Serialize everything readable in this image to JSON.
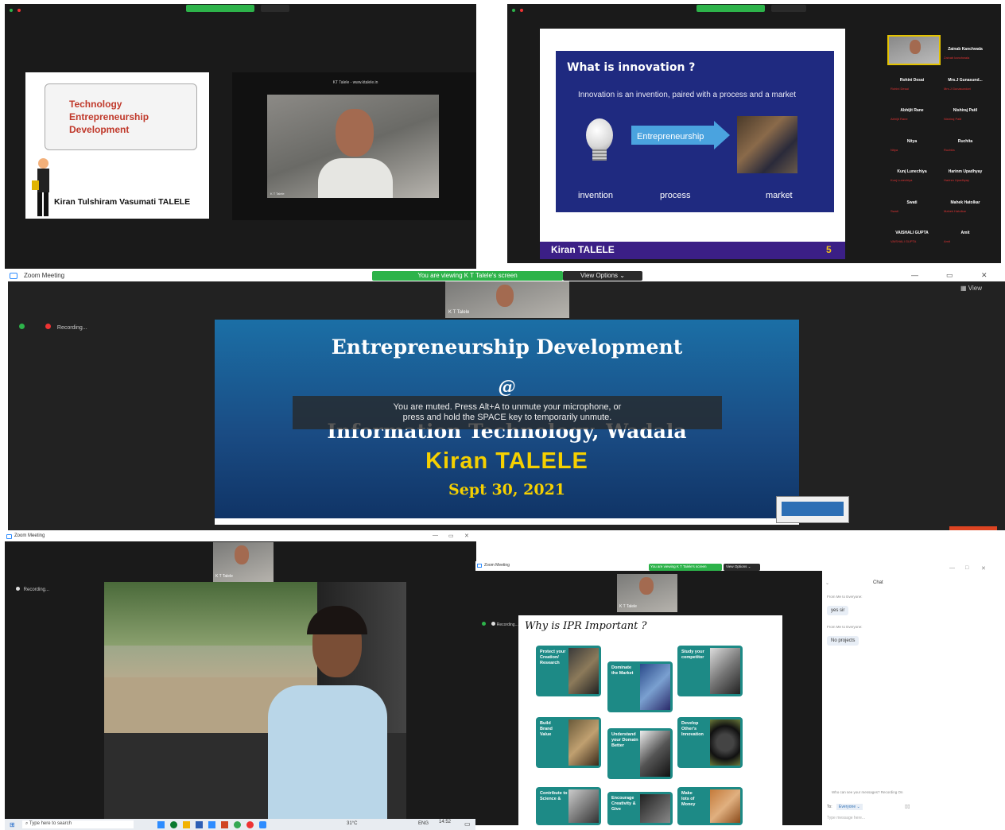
{
  "pane1": {
    "slide_title_lines": [
      "Technology",
      "Entrepreneurship",
      "Development"
    ],
    "presenter_name": "Kiran Tulshiram Vasumati TALELE",
    "video_label": "KT Talele - www.ktalele.in",
    "tile_name": "K T Talele"
  },
  "pane2": {
    "slide_heading": "What is innovation ?",
    "slide_text": "Innovation is an invention, paired with a process and a market",
    "arrow_label": "Entrepreneurship",
    "labels": [
      "invention",
      "process",
      "market"
    ],
    "footer_name": "Kiran TALELE",
    "slide_number": "5",
    "participants": [
      {
        "name": "Zainab Kanchwala",
        "sub": "Zainab kanchwala"
      },
      {
        "name": "Rohini Desai",
        "sub": "Rohini Desai"
      },
      {
        "name": "Mrs.J Gunasund...",
        "sub": "Mrs.J Gunasundari"
      },
      {
        "name": "Abhijit Rane",
        "sub": "Abhijit Rane"
      },
      {
        "name": "Nishiraj Patil",
        "sub": "Nishiraj Patil"
      },
      {
        "name": "Nitya",
        "sub": "Nitya"
      },
      {
        "name": "Ruchita",
        "sub": "Ruchita"
      },
      {
        "name": "Kunj Lunechiya",
        "sub": "Kunj Lunechiya"
      },
      {
        "name": "Harinm Upadhyay",
        "sub": "Harinm Upadhyay"
      },
      {
        "name": "Swati",
        "sub": "Swati"
      },
      {
        "name": "Mahek Hatolkar",
        "sub": "Mahek Hatolkar"
      },
      {
        "name": "VAISHALI GUPTA",
        "sub": "VAISHALI GUPTA"
      },
      {
        "name": "Amit",
        "sub": "Amit"
      }
    ]
  },
  "pane3": {
    "window_title": "Zoom Meeting",
    "viewing_text": "You are viewing K T Talele's screen",
    "view_options": "View Options ⌄",
    "view_label": "View",
    "tile_name": "K T Talele",
    "recording": "Recording...",
    "slide_title": "Entrepreneurship Development",
    "at": "@",
    "institute": "Information Technology, Wadala",
    "muted_line1": "You are muted. Press Alt+A to unmute your microphone, or",
    "muted_line2": "press and hold the SPACE key to temporarily unmute.",
    "speaker": "Kiran TALELE",
    "date": "Sept 30, 2021"
  },
  "pane4": {
    "window_title": "Zoom Meeting",
    "recording": "Recording...",
    "tile_name": "K T Talele",
    "taskbar_search": "Type here to search",
    "temperature": "31°C",
    "language": "ENG",
    "time": "14:52"
  },
  "pane5": {
    "window_title": "Zoom Meeting",
    "viewing_text": "You are viewing K T Talele's screen",
    "view_options": "View Options ⌄",
    "recording": "Recording...",
    "tile_name": "K T Talele",
    "slide_title": "Why is IPR Important ?",
    "cards": [
      "Protect your Creation/ Research",
      "Dominate the Market",
      "Study your competitor",
      "Build Brand Value",
      "Understand your Domain Better",
      "Develop Other's Innovation",
      "Contribute to Science &",
      "Encourage Creativity & Give",
      "Make lots of Money"
    ],
    "chat_title": "Chat",
    "chat_messages": [
      {
        "from": "From Me to Everyone:",
        "text": "yes sir"
      },
      {
        "from": "From Me to Everyone:",
        "text": "No projects"
      }
    ],
    "recording_notice": "Who can see your messages? Recording On",
    "to_label": "To:",
    "to_value": "Everyone ⌄",
    "placeholder": "Type message here..."
  }
}
